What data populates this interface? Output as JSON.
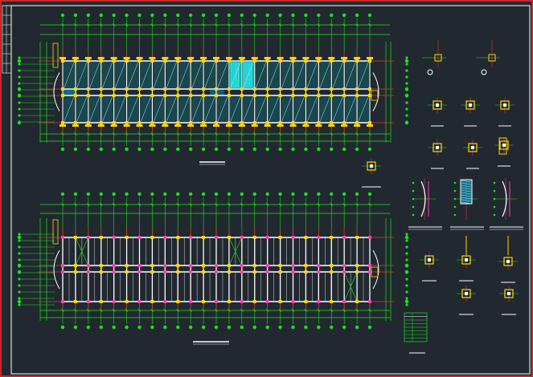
{
  "drawing": {
    "background": "#212830",
    "colors": {
      "frame_outer": "#c62828",
      "frame_inner": "#ffffff",
      "axis_grid": "#e53935",
      "dimension": "#19e619",
      "beam": "#ffffff",
      "column": "#ffd600",
      "column_alt": "#ff3fb4",
      "slab_fill": "#00c8c8",
      "slab_line": "#bfe8ff",
      "opening_mark": "#1fd21f"
    },
    "plans": [
      {
        "id": "upper-plan",
        "kind": "floor-framing-plan",
        "slab_panels": true,
        "title_underline": true
      },
      {
        "id": "lower-plan",
        "kind": "roof-framing-plan",
        "slab_panels": false,
        "title_underline": true
      }
    ],
    "detail_groups": [
      {
        "id": "column-details-top",
        "count": 8
      },
      {
        "id": "wall-sections",
        "count": 3
      },
      {
        "id": "column-details-bottom",
        "count": 5
      },
      {
        "id": "schedule-table",
        "count": 1
      }
    ],
    "bays": 24,
    "spans": 3
  }
}
